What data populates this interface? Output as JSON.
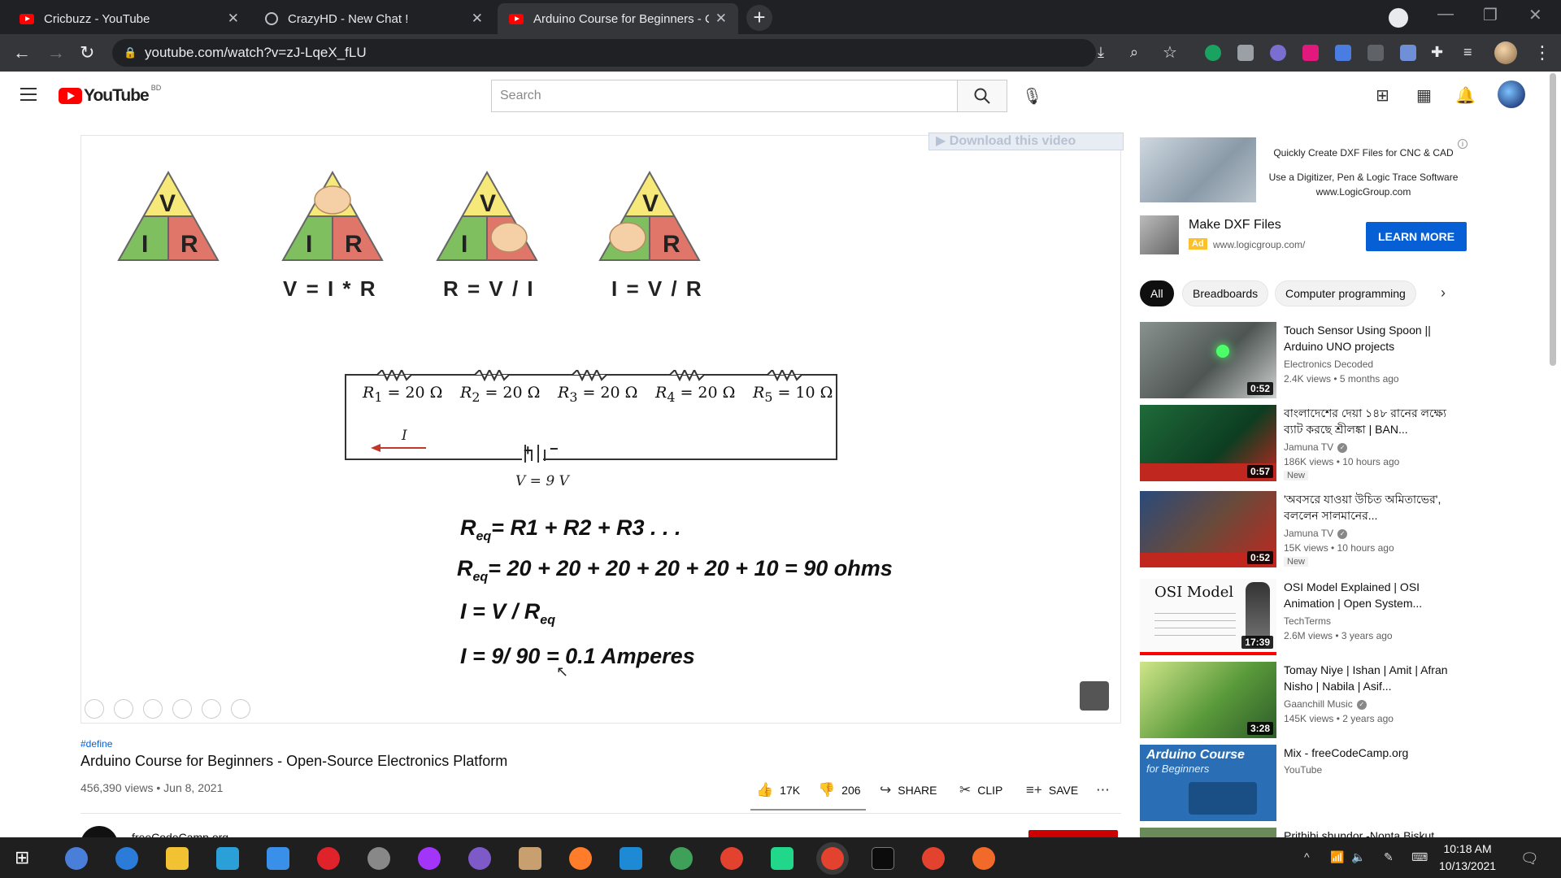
{
  "browser": {
    "tabs": [
      {
        "title": "Cricbuzz - YouTube",
        "icon": "youtube-icon"
      },
      {
        "title": "CrazyHD - New Chat !",
        "icon": "globe-icon"
      },
      {
        "title": "Arduino Course for Beginners - C",
        "icon": "youtube-icon"
      }
    ],
    "url": "youtube.com/watch?v=zJ-LqeX_fLU"
  },
  "youtube": {
    "logo_text": "YouTube",
    "country_code": "BD",
    "search_placeholder": "Search"
  },
  "player": {
    "download_label": "Download this video",
    "triangles": [
      {
        "top": "V",
        "left": "I",
        "right": "R"
      },
      {
        "top": "",
        "left": "I",
        "right": "R"
      },
      {
        "top": "V",
        "left": "I",
        "right": ""
      },
      {
        "top": "V",
        "left": "",
        "right": "R"
      }
    ],
    "formulas": [
      "V = I * R",
      "R = V / I",
      "I = V / R"
    ],
    "resistors": [
      {
        "name": "R",
        "sub": "1",
        "value": "= 20 Ω"
      },
      {
        "name": "R",
        "sub": "2",
        "value": "= 20 Ω"
      },
      {
        "name": "R",
        "sub": "3",
        "value": "= 20 Ω"
      },
      {
        "name": "R",
        "sub": "4",
        "value": "= 20 Ω"
      },
      {
        "name": "R",
        "sub": "5",
        "value": "= 10 Ω"
      }
    ],
    "current_label": "I",
    "voltage_label": "V = 9 V",
    "equations": [
      {
        "pre": "R",
        "sub": "eq",
        "post": "= R1 + R2 + R3 . . ."
      },
      {
        "pre": "R",
        "sub": "eq",
        "post": "= 20 + 20 + 20 + 20 + 20 + 10  = 90 ohms"
      },
      {
        "pre": "I = V / R",
        "sub": "eq",
        "post": ""
      },
      {
        "pre": "I = 9/ 90 = 0.1 Amperes",
        "sub": "",
        "post": ""
      }
    ]
  },
  "video": {
    "hashtag": "#define",
    "title": "Arduino Course for Beginners - Open-Source Electronics Platform",
    "views_date": "456,390 views • Jun 8, 2021",
    "likes": "17K",
    "dislikes": "206",
    "share": "SHARE",
    "clip": "CLIP",
    "save": "SAVE"
  },
  "ad": {
    "banner_line1": "Quickly Create DXF Files for CNC & CAD",
    "banner_line2": "Use a Digitizer, Pen & Logic Trace Software",
    "banner_line3": "www.LogicGroup.com",
    "title": "Make DXF Files",
    "badge": "Ad",
    "url": "www.logicgroup.com/",
    "cta": "LEARN MORE"
  },
  "chips": [
    "All",
    "Breadboards",
    "Computer programming"
  ],
  "recommendations": [
    {
      "title": "Touch Sensor Using Spoon || Arduino UNO projects",
      "channel": "Electronics Decoded",
      "verified": false,
      "meta": "2.4K views • 5 months ago",
      "badge": "",
      "duration": "0:52"
    },
    {
      "title": "বাংলাদেশের দেয়া ১৪৮ রানের লক্ষ্যে ব্যাট করছে শ্রীলঙ্কা | BAN...",
      "channel": "Jamuna TV",
      "verified": true,
      "meta": "186K views • 10 hours ago",
      "badge": "New",
      "duration": "0:57"
    },
    {
      "title": "'অবসরে যাওয়া উচিত অমিতাভের', বললেন সালমানের...",
      "channel": "Jamuna TV",
      "verified": true,
      "meta": "15K views • 10 hours ago",
      "badge": "New",
      "duration": "0:52"
    },
    {
      "title": "OSI Model Explained | OSI Animation | Open System...",
      "channel": "TechTerms",
      "verified": false,
      "meta": "2.6M views • 3 years ago",
      "badge": "",
      "duration": "17:39"
    },
    {
      "title": "Tomay Niye | Ishan | Amit | Afran Nisho | Nabila | Asif...",
      "channel": "Gaanchill Music",
      "verified": true,
      "meta": "145K views • 2 years ago",
      "badge": "",
      "duration": "3:28"
    },
    {
      "title": "Mix - freeCodeCamp.org",
      "channel": "YouTube",
      "verified": false,
      "meta": "",
      "badge": "",
      "duration": ""
    },
    {
      "title": "Prithibi shundor -Nonta Biskut",
      "channel": "",
      "verified": false,
      "meta": "",
      "badge": "",
      "duration": ""
    }
  ],
  "thumb_texts": {
    "osi": "OSI Model",
    "arduino_line1": "Arduino Course",
    "arduino_line2": "for Beginners"
  },
  "channel_peek": "freeCodeCamp.org",
  "taskbar": {
    "time": "10:18 AM",
    "date": "10/13/2021"
  }
}
